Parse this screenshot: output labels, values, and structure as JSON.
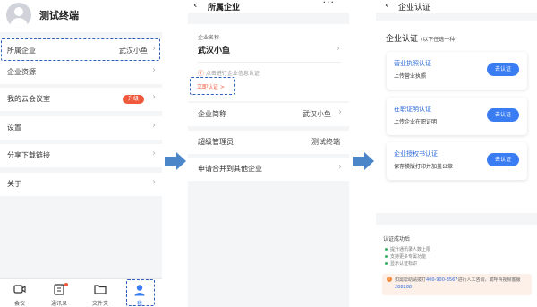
{
  "panel1": {
    "profile_name": "测试终端",
    "rows": [
      {
        "label": "所属企业",
        "value": "武汉小鱼"
      },
      {
        "label": "企业资源"
      },
      {
        "label": "我的云会议室",
        "badge": "升级"
      },
      {
        "label": "设置"
      },
      {
        "label": "分享下载链接"
      },
      {
        "label": "关于"
      }
    ],
    "tabs": [
      {
        "label": "会议",
        "icon": "video-camera-icon"
      },
      {
        "label": "通讯录",
        "icon": "contacts-icon"
      },
      {
        "label": "文件夹",
        "icon": "folder-icon"
      },
      {
        "label": "我",
        "icon": "person-icon"
      }
    ]
  },
  "panel2": {
    "title": "所属企业",
    "company_label": "企业名称",
    "company_name": "武汉小鱼",
    "warning": "点击进行企业信息认证",
    "certify_link": "立即认证 >",
    "rows": [
      {
        "label": "企业简称",
        "value": "武汉小鱼"
      },
      {
        "label": "超级管理员",
        "value": "测试终端"
      },
      {
        "label": "申请合并到其他企业"
      }
    ]
  },
  "panel3": {
    "title": "企业认证",
    "heading": "企业认证",
    "heading_sub": "(以下任选一种)",
    "options": [
      {
        "title": "营业执照认证",
        "desc": "上传营业执照",
        "button": "去认证"
      },
      {
        "title": "在职证明认证",
        "desc": "上传企业在职证明",
        "button": "去认证"
      },
      {
        "title": "企业授权书认证",
        "desc": "保存模版打印并加盖公章",
        "button": "去认证"
      }
    ],
    "after_title": "认证成功后",
    "benefits": [
      "提升通讯录人数上限",
      "支持更多专属功能",
      "显示认证标识"
    ],
    "notice_prefix": "如需帮助请拨打",
    "notice_phone": "400-900-3567",
    "notice_mid": "进行人工咨询，或呼叫视频客服",
    "notice_id": "288288"
  },
  "colors": {
    "accent": "#3a7cf2",
    "warn": "#f05a3c",
    "guide": "#2f5fbd",
    "arrow": "#4a86c8"
  }
}
